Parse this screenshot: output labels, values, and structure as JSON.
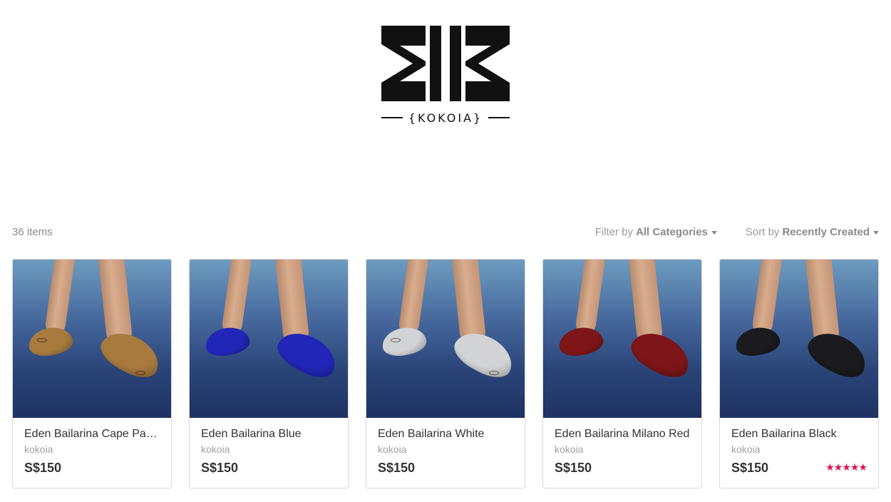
{
  "brand": {
    "logo_text": "{KOKOIA}"
  },
  "toolbar": {
    "item_count": "36 items",
    "filter_prefix": "Filter by",
    "filter_value": "All Categories",
    "sort_prefix": "Sort by",
    "sort_value": "Recently Created"
  },
  "products": [
    {
      "name": "Eden Bailarina Cape Palli…",
      "creator": "kokoia",
      "price": "S$150",
      "shoe_color": "#a97a3e",
      "rating": null
    },
    {
      "name": "Eden Bailarina Blue",
      "creator": "kokoia",
      "price": "S$150",
      "shoe_color": "#2226b8",
      "rating": null
    },
    {
      "name": "Eden Bailarina White",
      "creator": "kokoia",
      "price": "S$150",
      "shoe_color": "#d2d3d6",
      "rating": null
    },
    {
      "name": "Eden Bailarina Milano Red",
      "creator": "kokoia",
      "price": "S$150",
      "shoe_color": "#7e1518",
      "rating": null
    },
    {
      "name": "Eden Bailarina Black",
      "creator": "kokoia",
      "price": "S$150",
      "shoe_color": "#1a1a1f",
      "rating": "★★★★★"
    }
  ],
  "colors": {
    "accent_star": "#e6114e",
    "muted_text": "#a0a0a0"
  }
}
